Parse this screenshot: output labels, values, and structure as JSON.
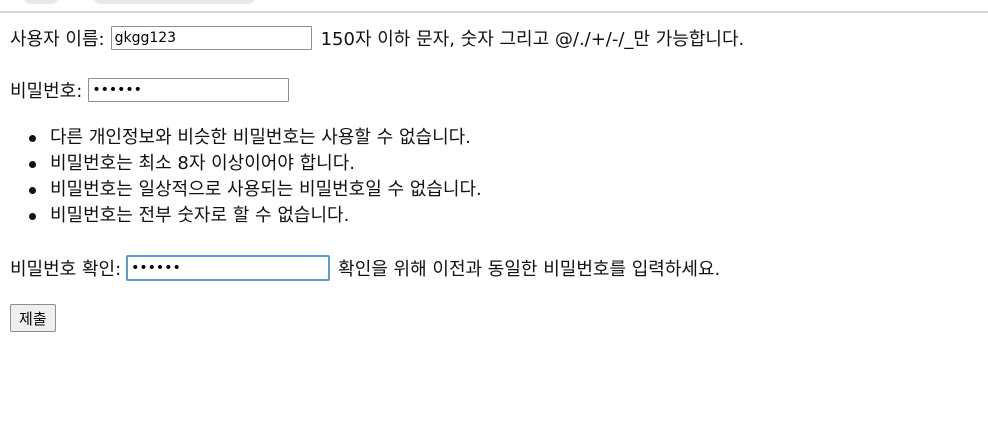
{
  "form": {
    "username": {
      "label": "사용자 이름:",
      "value": "gkgg123",
      "help": "150자 이하 문자, 숫자 그리고 @/./+/-/_만 가능합니다."
    },
    "password": {
      "label": "비밀번호:",
      "value": "......",
      "rules": [
        "다른 개인정보와 비슷한 비밀번호는 사용할 수 없습니다.",
        "비밀번호는 최소 8자 이상이어야 합니다.",
        "비밀번호는 일상적으로 사용되는 비밀번호일 수 없습니다.",
        "비밀번호는 전부 숫자로 할 수 없습니다."
      ]
    },
    "password_confirm": {
      "label": "비밀번호 확인:",
      "value": "......",
      "help": "확인을 위해 이전과 동일한 비밀번호를 입력하세요."
    },
    "submit_label": "제출"
  },
  "colors": {
    "focus_border": "#5b9bd5",
    "input_border": "#8f8f8f",
    "button_bg": "#efefef"
  }
}
